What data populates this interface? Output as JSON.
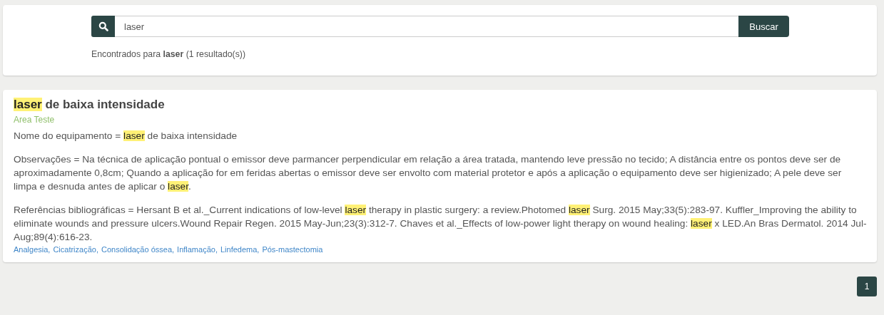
{
  "search": {
    "value": "laser",
    "button": "Buscar"
  },
  "summary": "Encontrados para **laser** (1 resultado(s))",
  "result": {
    "title": [
      {
        "text": "laser",
        "highlight": true
      },
      {
        "text": " de baixa intensidade",
        "highlight": false
      }
    ],
    "area": "Area Teste",
    "paragraphs": [
      [
        {
          "text": "Nome do equipamento = ",
          "highlight": false
        },
        {
          "text": "laser",
          "highlight": true
        },
        {
          "text": " de baixa intensidade",
          "highlight": false
        }
      ],
      [
        {
          "text": "Observações = Na técnica de aplicação pontual o emissor deve parmancer perpendicular em relação a área tratada, mantendo leve pressão no tecido; A distância entre os pontos deve ser de aproximadamente 0,8cm; Quando a aplicação for em feridas abertas o emissor deve ser envolto com material protetor e após a aplicação o equipamento deve ser higienizado; A pele deve ser limpa e desnuda antes de aplicar o ",
          "highlight": false
        },
        {
          "text": "laser",
          "highlight": true
        },
        {
          "text": ".",
          "highlight": false
        }
      ],
      [
        {
          "text": "Referências bibliográficas = Hersant B et al._Current indications of low-level ",
          "highlight": false
        },
        {
          "text": "laser",
          "highlight": true
        },
        {
          "text": " therapy in plastic surgery: a review.Photomed ",
          "highlight": false
        },
        {
          "text": "laser",
          "highlight": true
        },
        {
          "text": " Surg. 2015 May;33(5):283-97. Kuffler_Improving the ability to eliminate wounds and pressure ulcers.Wound Repair Regen. 2015 May-Jun;23(3):312-7. Chaves et al._Effects of low-power light therapy on wound healing: ",
          "highlight": false
        },
        {
          "text": "laser",
          "highlight": true
        },
        {
          "text": " x LED.An Bras Dermatol. 2014 Jul-Aug;89(4):616-23.",
          "highlight": false
        }
      ]
    ],
    "tags": [
      "Analgesia,",
      "Cicatrização,",
      "Consolidação óssea,",
      "Inflamação,",
      "Linfedema,",
      "Pós-mastectomia"
    ]
  },
  "pagination": [
    {
      "label": "1",
      "selected": true
    }
  ]
}
